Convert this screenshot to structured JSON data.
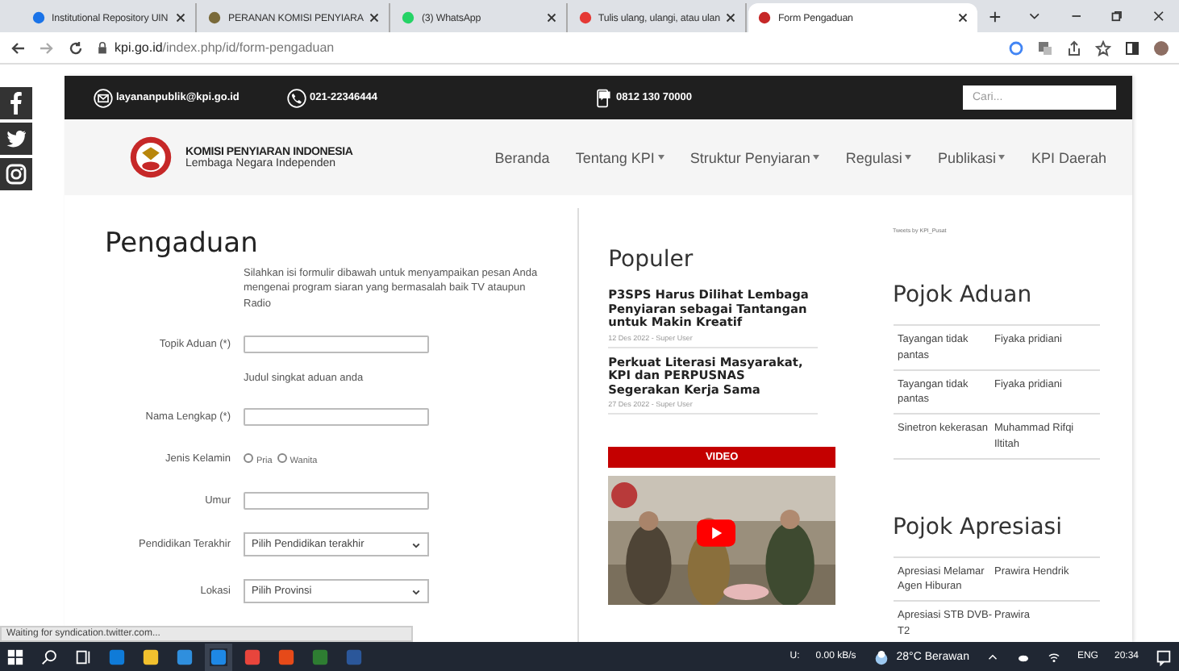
{
  "browser": {
    "tabs": [
      {
        "title": "Institutional Repository UIN",
        "selected": false
      },
      {
        "title": "PERANAN KOMISI PENYIARA",
        "selected": false
      },
      {
        "title": "(3) WhatsApp",
        "selected": false
      },
      {
        "title": "Tulis ulang, ulangi, atau ulan",
        "selected": false
      },
      {
        "title": "Form Pengaduan",
        "selected": true
      }
    ],
    "url_host": "kpi.go.id",
    "url_path": "/index.php/id/form-pengaduan"
  },
  "topbar": {
    "email": "layananpublik@kpi.go.id",
    "phone": "021-22346444",
    "whatsapp": "0812 130 70000",
    "search": {
      "placeholder": "Cari..."
    }
  },
  "brand": {
    "name": "KOMISI PENYIARAN INDONESIA",
    "tagline": "Lembaga Negara Independen"
  },
  "nav": [
    {
      "label": "Beranda",
      "dropdown": false
    },
    {
      "label": "Tentang KPI",
      "dropdown": true
    },
    {
      "label": "Struktur Penyiaran",
      "dropdown": true
    },
    {
      "label": "Regulasi",
      "dropdown": true
    },
    {
      "label": "Publikasi",
      "dropdown": true
    },
    {
      "label": "KPI Daerah",
      "dropdown": false
    }
  ],
  "form": {
    "title": "Pengaduan",
    "intro": "Silahkan isi formulir dibawah untuk menyampaikan pesan Anda mengenai program siaran yang bermasalah baik TV ataupun Radio",
    "fields": [
      {
        "kind": "text",
        "label": "Topik Aduan (*)",
        "hint": "Judul singkat aduan anda"
      },
      {
        "kind": "text",
        "label": "Nama Lengkap (*)"
      },
      {
        "kind": "radio",
        "label": "Jenis Kelamin",
        "options": [
          {
            "label": "Pria",
            "selected": false
          },
          {
            "label": "Wanita",
            "selected": false
          }
        ]
      },
      {
        "kind": "text",
        "label": "Umur"
      },
      {
        "kind": "select",
        "label": "Pendidikan Terakhir",
        "value": "Pilih Pendidikan terakhir"
      },
      {
        "kind": "select",
        "label": "Lokasi",
        "value": "Pilih Provinsi"
      }
    ]
  },
  "populer": {
    "title": "Populer",
    "articles": [
      {
        "title": "P3SPS Harus Dilihat Lembaga Penyiaran sebagai Tantangan untuk Makin Kreatif",
        "meta": "12 Des 2022 - Super User"
      },
      {
        "title": "Perkuat Literasi Masyarakat, KPI dan PERPUSNAS Segerakan Kerja Sama",
        "meta": "27 Des 2022 - Super User"
      }
    ]
  },
  "video": {
    "label": "VIDEO"
  },
  "tweets": "Tweets by KPI_Pusat",
  "pojok_aduan": {
    "title": "Pojok Aduan",
    "rows": [
      [
        "Tayangan tidak pantas",
        "Fiyaka pridiani"
      ],
      [
        "Tayangan tidak pantas",
        "Fiyaka pridiani"
      ],
      [
        "Sinetron kekerasan",
        "Muhammad Rifqi Iltitah"
      ]
    ]
  },
  "pojok_apresiasi": {
    "title": "Pojok Apresiasi",
    "rows": [
      [
        "Apresiasi Melamar Agen Hiburan",
        "Prawira Hendrik"
      ],
      [
        "Apresiasi STB DVB-T2",
        "Prawira"
      ]
    ]
  },
  "status_text": "Waiting for syndication.twitter.com...",
  "taskbar": {
    "net_up_label": "U:",
    "net_up": "0.00 kB/s",
    "weather": "28°C Berawan",
    "lang": "ENG",
    "time": "20:34"
  }
}
